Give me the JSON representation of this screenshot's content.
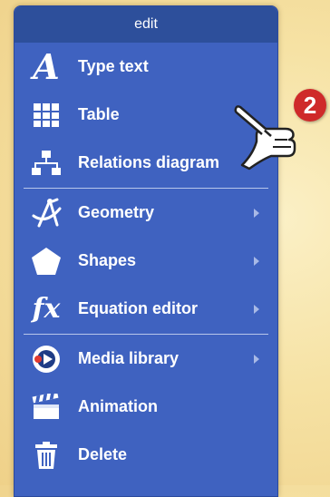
{
  "menu": {
    "title": "edit",
    "items": [
      {
        "label": "Type text",
        "icon": "type-text-icon",
        "submenu": false
      },
      {
        "label": "Table",
        "icon": "table-grid-icon",
        "submenu": false
      },
      {
        "label": "Relations diagram",
        "icon": "relations-diagram-icon",
        "submenu": false
      },
      {
        "label": "Geometry",
        "icon": "geometry-compass-icon",
        "submenu": true
      },
      {
        "label": "Shapes",
        "icon": "pentagon-icon",
        "submenu": true
      },
      {
        "label": "Equation editor",
        "icon": "fx-icon",
        "submenu": true
      },
      {
        "label": "Media library",
        "icon": "media-play-icon",
        "submenu": true
      },
      {
        "label": "Animation",
        "icon": "clapperboard-icon",
        "submenu": false
      },
      {
        "label": "Delete",
        "icon": "trash-icon",
        "submenu": false
      }
    ]
  },
  "badge": {
    "number": "2"
  },
  "colors": {
    "menu_bg": "#3f62c0",
    "header_bg": "#2d4f9b",
    "badge_red": "#cf2a2a",
    "background": "#f6e2a4"
  }
}
